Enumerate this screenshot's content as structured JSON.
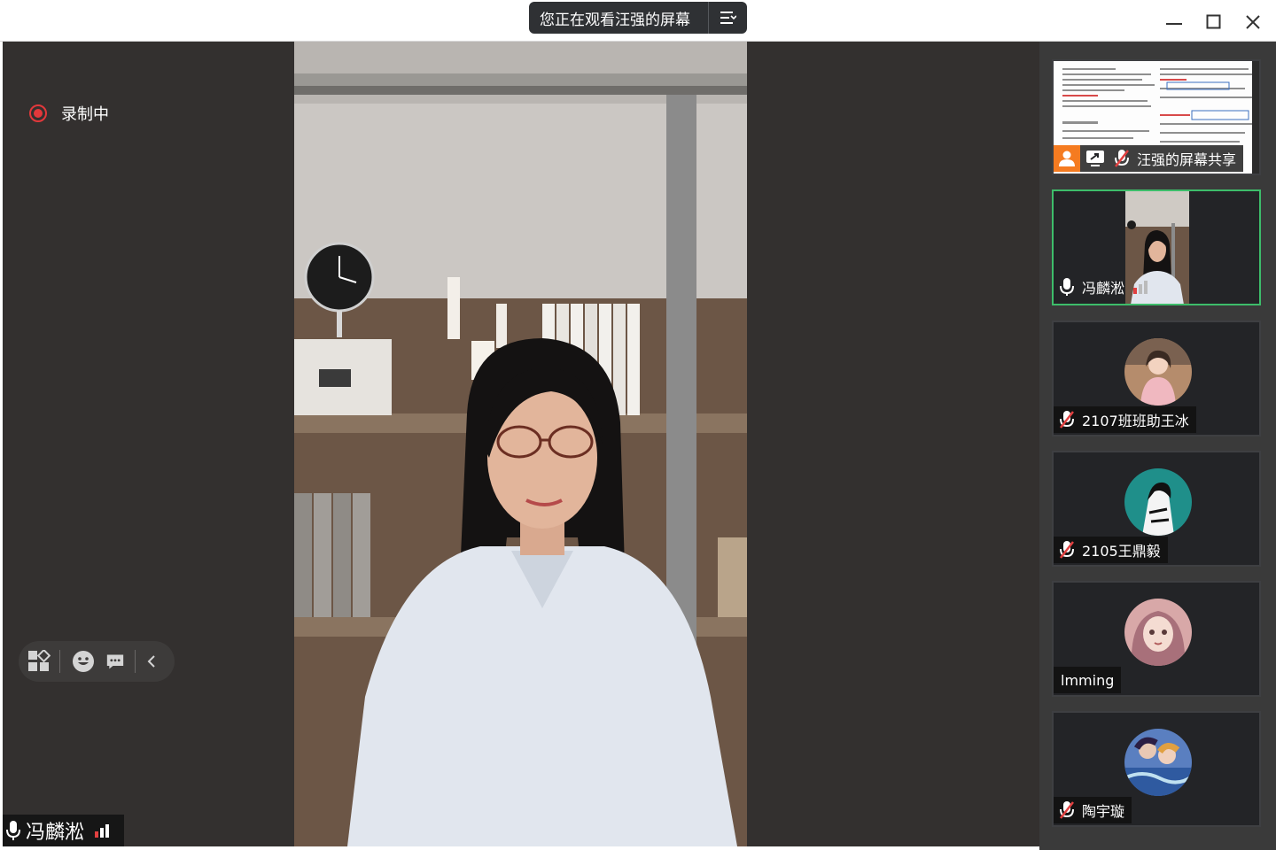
{
  "window": {
    "share_banner": "您正在观看汪强的屏幕",
    "menu_icon": "list-menu-icon",
    "controls": [
      "minimize-icon",
      "maximize-icon",
      "close-icon"
    ]
  },
  "stage": {
    "recording_label": "录制中",
    "speaker_name": "冯麟淞",
    "toolbar_icons": [
      "layout-icon",
      "emoji-icon",
      "chat-icon",
      "collapse-icon"
    ]
  },
  "participants": [
    {
      "name": "汪强的屏幕共享",
      "type": "screen-share",
      "mic": "muted"
    },
    {
      "name": "冯麟淞",
      "type": "video",
      "mic": "on",
      "active": true
    },
    {
      "name": "2107班班助王冰",
      "type": "avatar",
      "mic": "muted"
    },
    {
      "name": "2105王鼎毅",
      "type": "avatar",
      "mic": "muted"
    },
    {
      "name": "lmming",
      "type": "avatar",
      "mic": "none"
    },
    {
      "name": "陶宇璇",
      "type": "avatar",
      "mic": "muted"
    }
  ],
  "colors": {
    "recording": "#e2383b",
    "active_border": "#3dbd6a",
    "signal": "#e24040",
    "mic_on": "#ffffff",
    "accent_orange": "#f57b20"
  }
}
